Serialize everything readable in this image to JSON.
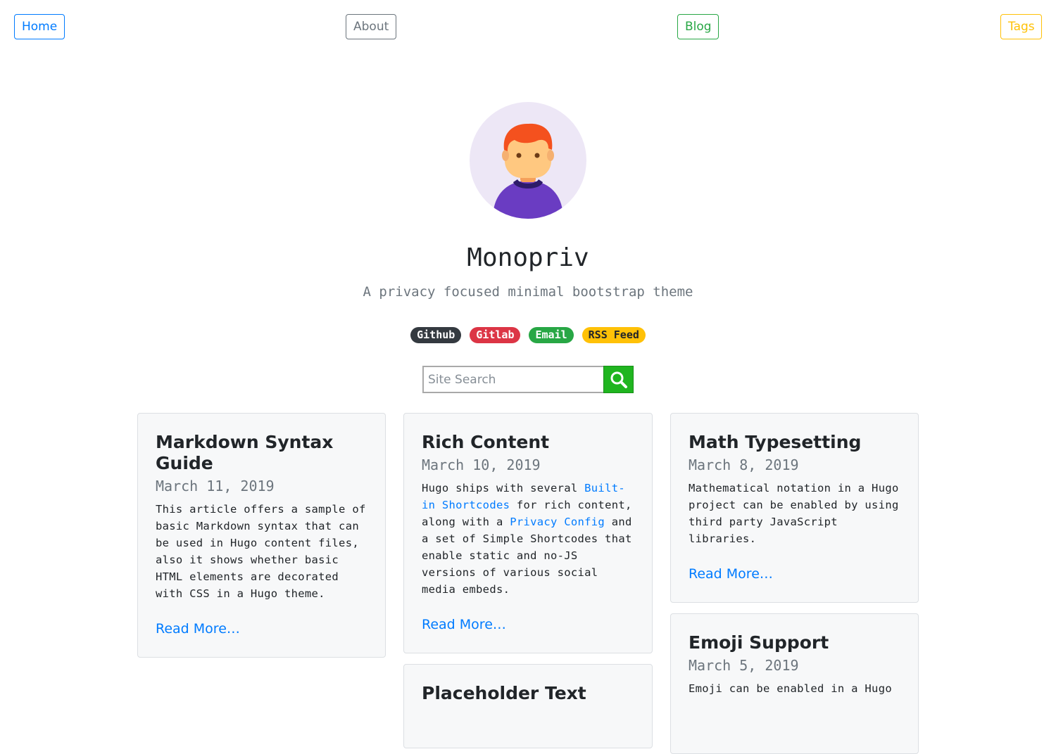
{
  "nav": {
    "home": "Home",
    "about": "About",
    "blog": "Blog",
    "tags": "Tags"
  },
  "hero": {
    "title": "Monopriv",
    "subtitle": "A privacy focused minimal bootstrap theme",
    "badges": [
      "Github",
      "Gitlab",
      "Email",
      "RSS Feed"
    ]
  },
  "search": {
    "placeholder": "Site Search",
    "icon": "search-icon"
  },
  "colors": {
    "primary": "#007bff",
    "secondary": "#6c757d",
    "success": "#28a745",
    "warning": "#ffc107",
    "danger": "#dc3545",
    "dark": "#343a40",
    "search_button": "#20b520"
  },
  "posts": [
    {
      "title": "Markdown Syntax Guide",
      "date": "March 11, 2019",
      "summary": "This article offers a sample of basic Markdown syntax that can be used in Hugo content files, also it shows whether basic HTML elements are decorated with CSS in a Hugo theme.",
      "read_more": "Read More…"
    },
    {
      "title": "Rich Content",
      "date": "March 10, 2019",
      "summary_parts": {
        "a": "Hugo ships with several ",
        "link1": "Built-in Shortcodes",
        "b": " for rich content, along with a ",
        "link2": "Privacy Config",
        "c": " and a set of Simple Shortcodes that enable static and no-JS versions of various social media embeds."
      },
      "read_more": "Read More…"
    },
    {
      "title": "Math Typesetting",
      "date": "March 8, 2019",
      "summary": "Mathematical notation in a Hugo project can be enabled by using third party JavaScript libraries.",
      "read_more": "Read More…"
    },
    {
      "title": "Emoji Support",
      "date": "March 5, 2019",
      "summary": "Emoji can be enabled in a Hugo"
    },
    {
      "title": "Placeholder Text"
    }
  ]
}
